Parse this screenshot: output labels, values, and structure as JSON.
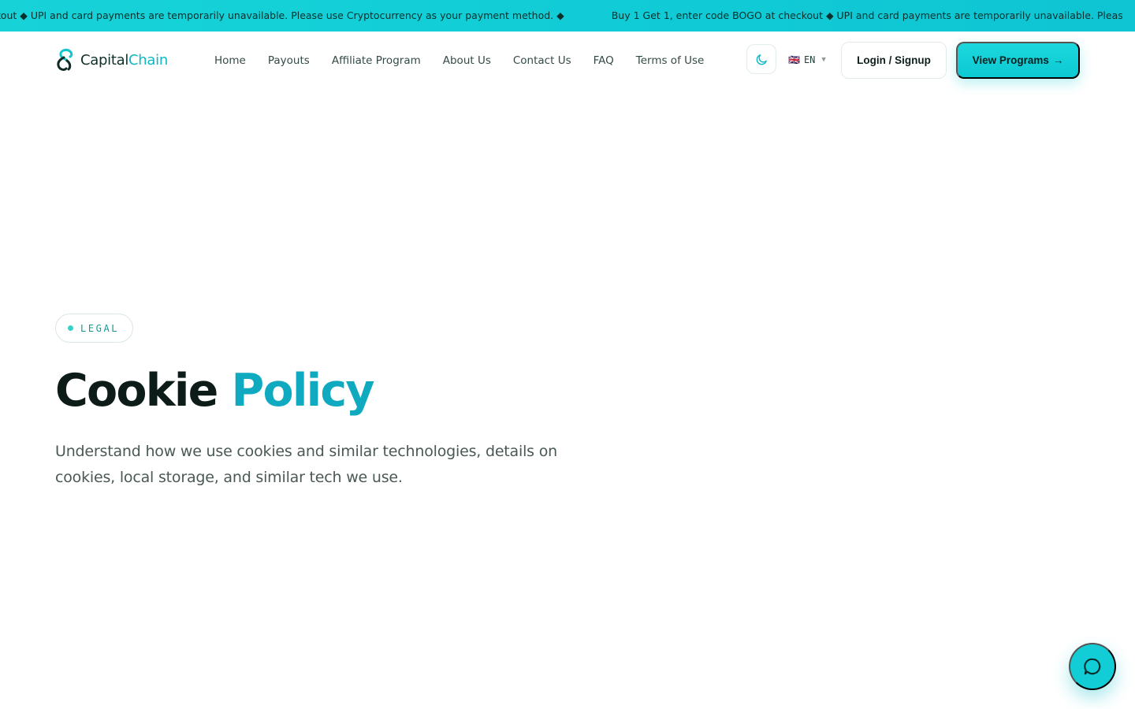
{
  "announcement": {
    "segment_1": "kout ◆ UPI and card payments are temporarily unavailable. Please use Cryptocurrency as your payment method. ◆",
    "segment_2": "Buy 1 Get 1, enter code BOGO at checkout ◆ UPI and card payments are temporarily unavailable. Pleas"
  },
  "brand": {
    "name_part_1": "Capital",
    "name_part_2": "Chain",
    "accent_color": "#10c9d4"
  },
  "nav": {
    "links": [
      {
        "label": "Home"
      },
      {
        "label": "Payouts"
      },
      {
        "label": "Affiliate Program"
      },
      {
        "label": "About Us"
      },
      {
        "label": "Contact Us"
      },
      {
        "label": "FAQ"
      },
      {
        "label": "Terms of Use"
      }
    ],
    "theme_icon": "moon-icon",
    "language": {
      "flag": "🇬🇧",
      "code": "EN"
    },
    "login_label": "Login / Signup",
    "cta_label": "View Programs",
    "cta_arrow": "→"
  },
  "hero": {
    "badge": "LEGAL",
    "title_part_1": "Cookie",
    "title_part_2": "Policy",
    "subtitle": "Understand how we use cookies and similar technologies, details on cookies, local storage, and similar tech we use."
  },
  "chat": {
    "icon": "chat-bubble-icon"
  }
}
